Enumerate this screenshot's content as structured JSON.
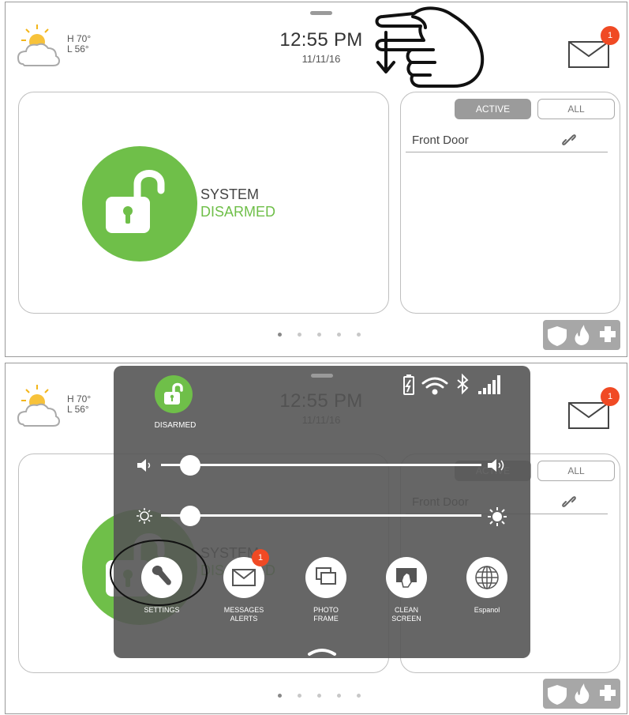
{
  "header": {
    "weather": {
      "high": "H 70°",
      "low": "L 56°"
    },
    "time": "12:55 PM",
    "date": "11/11/16",
    "messages_badge": "1"
  },
  "arming": {
    "line1": "SYSTEM",
    "line2": "DISARMED",
    "color": "#6fbf49"
  },
  "sensors": {
    "tabs": [
      "ACTIVE",
      "ALL"
    ],
    "selected_tab": "ACTIVE",
    "items": [
      {
        "name": "Front Door",
        "icon": "link-icon"
      }
    ]
  },
  "pager": {
    "pages": 5,
    "current": 1
  },
  "emergency": {
    "icons": [
      "shield-icon",
      "fire-icon",
      "medical-cross-icon"
    ]
  },
  "quick_panel": {
    "status_label": "DISARMED",
    "system_icons": [
      "battery-charging-icon",
      "wifi-icon",
      "bluetooth-icon",
      "cellular-signal-icon"
    ],
    "volume_level": 0,
    "brightness_level": 0,
    "buttons": [
      {
        "id": "settings",
        "label": "SETTINGS",
        "icon": "wrench-icon"
      },
      {
        "id": "messages",
        "label": "MESSAGES\nALERTS",
        "icon": "mail-icon",
        "badge": "1"
      },
      {
        "id": "photo",
        "label": "PHOTO\nFRAME",
        "icon": "photo-frame-icon"
      },
      {
        "id": "clean",
        "label": "CLEAN\nSCREEN",
        "icon": "clean-screen-icon"
      },
      {
        "id": "lang",
        "label": "Espanol",
        "icon": "globe-icon"
      }
    ]
  },
  "colors": {
    "accent_green": "#6fbf49",
    "badge_red": "#f04a24",
    "overlay_gray": "#555555"
  }
}
